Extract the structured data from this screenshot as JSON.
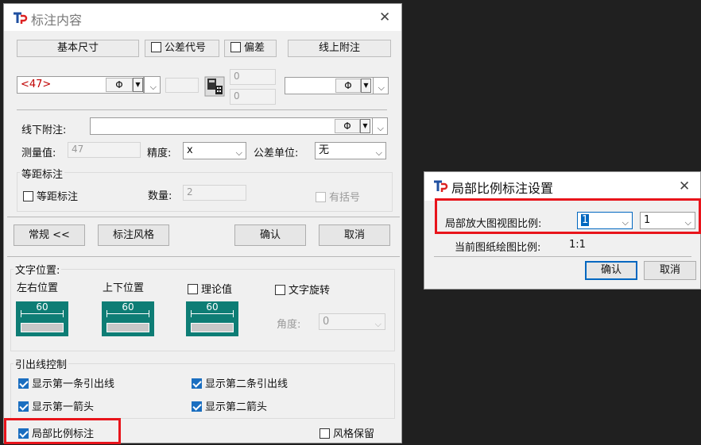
{
  "main_dialog": {
    "title": "标注内容",
    "header": {
      "basic_size": "基本尺寸",
      "tolerance_code": "公差代号",
      "deviation": "偏差",
      "upper_note": "线上附注"
    },
    "size_value": "<47>",
    "phi_symbol": "Φ",
    "upper_dev": "0",
    "lower_dev": "0",
    "lower_note_label": "线下附注:",
    "lower_note_value": "",
    "measured_label": "测量值:",
    "measured_value": "47",
    "precision_label": "精度:",
    "precision_value": "x",
    "tol_unit_label": "公差单位:",
    "tol_unit_value": "无",
    "equal_group_label": "等距标注",
    "equal_checkbox_label": "等距标注",
    "count_label": "数量:",
    "count_value": "2",
    "bracket_label": "有括号",
    "buttons": {
      "general": "常规 <<",
      "style": "标注风格",
      "ok": "确认",
      "cancel": "取消"
    },
    "text_pos_label": "文字位置:",
    "lr_pos_label": "左右位置",
    "ud_pos_label": "上下位置",
    "theory_label": "理论值",
    "rotate_label": "文字旋转",
    "icon_num": "60",
    "angle_label": "角度:",
    "angle_value": "0",
    "leader_group_label": "引出线控制",
    "show_leader1": "显示第一条引出线",
    "show_leader2": "显示第二条引出线",
    "show_arrow1": "显示第一箭头",
    "show_arrow2": "显示第二箭头",
    "local_scale_label": "局部比例标注",
    "keep_style_label": "风格保留"
  },
  "scale_dialog": {
    "title": "局部比例标注设置",
    "ratio_label": "局部放大图视图比例:",
    "ratio_left": "1",
    "ratio_right": "1",
    "current_label": "当前图纸绘图比例:",
    "current_value": "1:1",
    "ok": "确认",
    "cancel": "取消"
  },
  "colors": {
    "accent": "#1a6ec0",
    "highlight": "#e8141b",
    "icon_teal": "#0e7d75"
  }
}
